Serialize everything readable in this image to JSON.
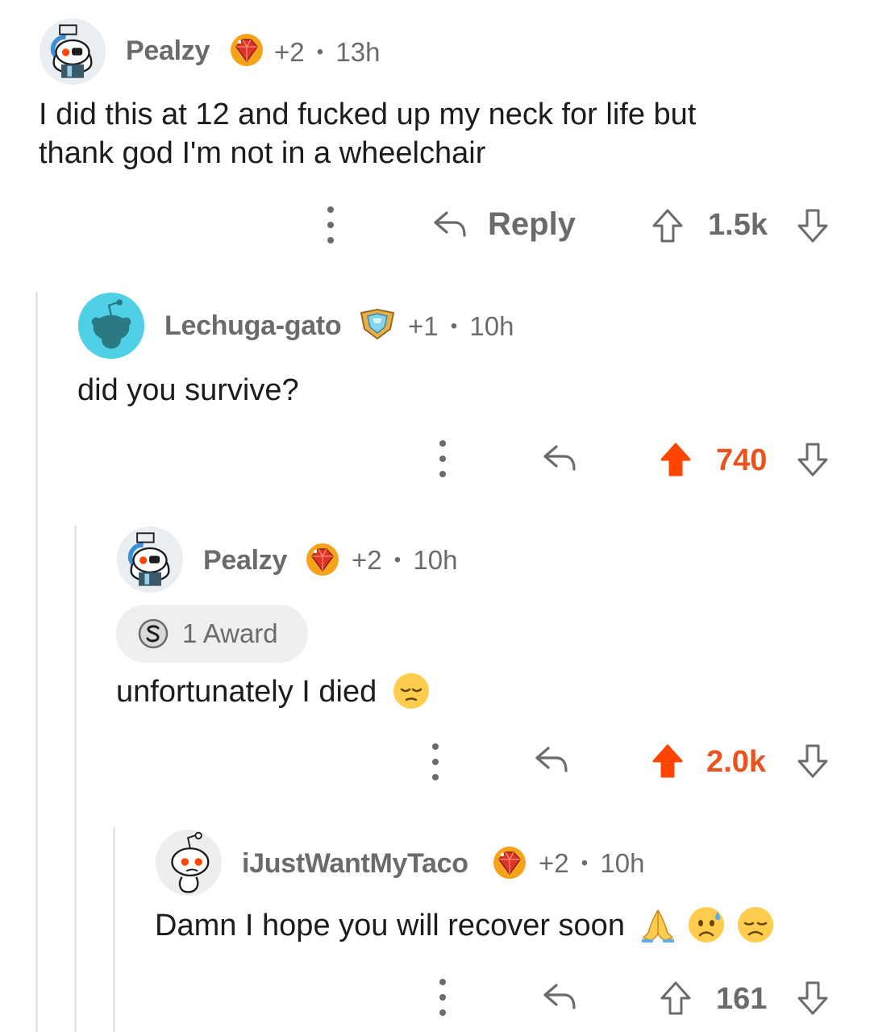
{
  "comments": [
    {
      "username": "Pealzy",
      "flair_count": "+2",
      "age": "13h",
      "body": "I did this at 12 and fucked up my neck for life but\nthank god I'm not in a wheelchair",
      "reply_label": "Reply",
      "score": "1.5k",
      "upvoted": false
    },
    {
      "username": "Lechuga-gato",
      "flair_count": "+1",
      "age": "10h",
      "body": "did you survive?",
      "score": "740",
      "upvoted": true
    },
    {
      "username": "Pealzy",
      "flair_count": "+2",
      "age": "10h",
      "award_label": "1 Award",
      "body": "unfortunately I died",
      "score": "2.0k",
      "upvoted": true
    },
    {
      "username": "iJustWantMyTaco",
      "flair_count": "+2",
      "age": "10h",
      "body": "Damn I hope you will recover soon",
      "score": "161",
      "upvoted": false
    }
  ],
  "separator": "•",
  "colors": {
    "upvote_active": "#ff4500",
    "score_active": "#e8541f",
    "meta_gray": "#6b6b6b",
    "thread_line": "#e6e6e6",
    "award_bg": "#efefef"
  },
  "icons": {
    "reply": "reply-arrow-icon",
    "upvote": "upvote-arrow-icon",
    "downvote": "downvote-arrow-icon",
    "more": "kebab-menu-icon",
    "award": "silver-award-icon",
    "flair_gem": "ruby-gem-flair-icon",
    "flair_shield": "diamond-shield-flair-icon"
  }
}
